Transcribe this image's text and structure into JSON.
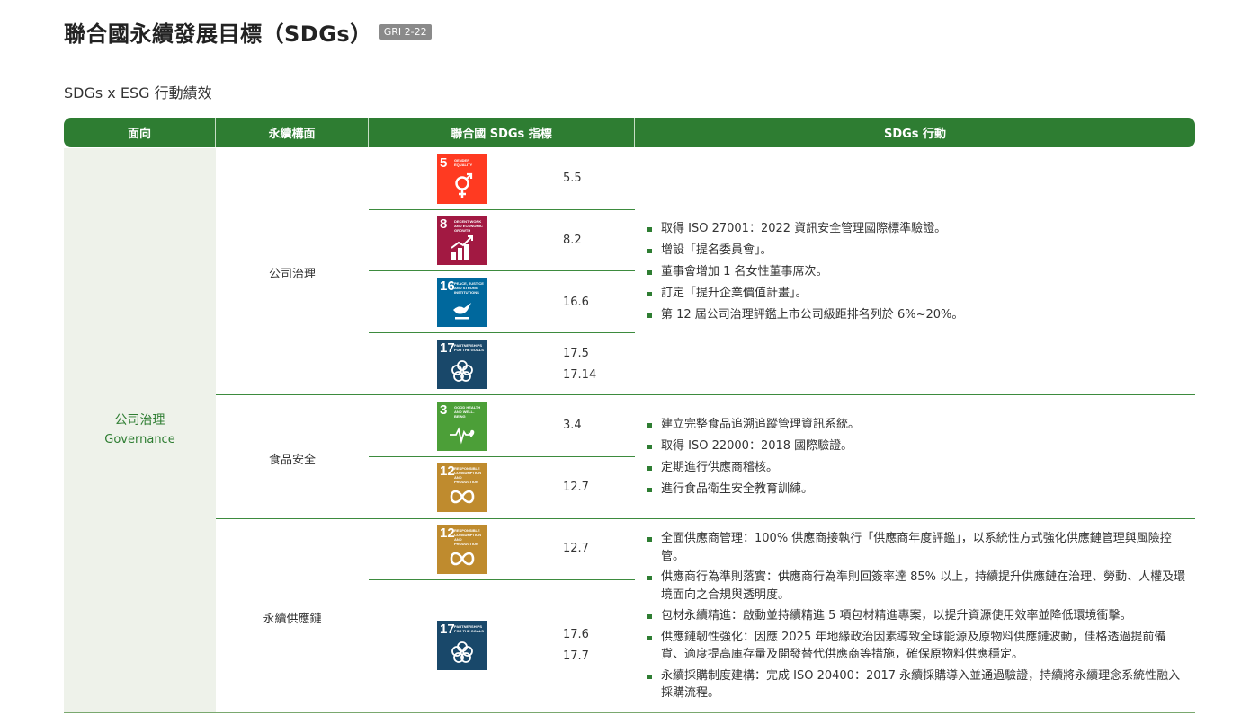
{
  "title": "聯合國永續發展目標（SDGs）",
  "gri_tag": "GRI 2-22",
  "subtitle": "SDGs x ESG 行動績效",
  "header": {
    "col1": "面向",
    "col2": "永續構面",
    "col3": "聯合國 SDGs 指標",
    "col4": "SDGs 行動"
  },
  "aspect": {
    "zh": "公司治理",
    "en": "Governance"
  },
  "sdg_icons": {
    "s3": {
      "num": "3",
      "caption": "GOOD HEALTH AND WELL-BEING",
      "color": "#4c9f38"
    },
    "s5": {
      "num": "5",
      "caption": "GENDER EQUALITY",
      "color": "#ff3a21"
    },
    "s8": {
      "num": "8",
      "caption": "DECENT WORK AND ECONOMIC GROWTH",
      "color": "#a21942"
    },
    "s12": {
      "num": "12",
      "caption": "RESPONSIBLE CONSUMPTION AND PRODUCTION",
      "color": "#bf8b2e"
    },
    "s16": {
      "num": "16",
      "caption": "PEACE, JUSTICE AND STRONG INSTITUTIONS",
      "color": "#00689d"
    },
    "s17": {
      "num": "17",
      "caption": "PARTNERSHIPS FOR THE GOALS",
      "color": "#19486a"
    }
  },
  "sections": [
    {
      "dimension": "公司治理",
      "indicators": [
        "5.5",
        "8.2",
        "16.6",
        "17.5",
        "17.14"
      ],
      "actions": [
        "取得 ISO 27001：2022 資訊安全管理國際標準驗證。",
        "增設「提名委員會」。",
        "董事會增加 1 名女性董事席次。",
        "訂定「提升企業價值計畫」。",
        "第 12 屆公司治理評鑑上市公司級距排名列於 6%~20%。"
      ]
    },
    {
      "dimension": "食品安全",
      "indicators": [
        "3.4",
        "12.7"
      ],
      "actions": [
        "建立完整食品追溯追蹤管理資訊系統。",
        "取得 ISO 22000：2018 國際驗證。",
        "定期進行供應商稽核。",
        "進行食品衛生安全教育訓練。"
      ]
    },
    {
      "dimension": "永續供應鏈",
      "indicators": [
        "12.7",
        "17.6",
        "17.7"
      ],
      "actions": [
        "全面供應商管理：100% 供應商接執行「供應商年度評鑑」，以系統性方式強化供應鏈管理與風險控管。",
        "供應商行為準則落實：供應商行為準則回簽率達 85% 以上，持續提升供應鏈在治理、勞動、人權及環境面向之合規與透明度。",
        "包材永續精進：啟動並持續精進 5 項包材精進專案，以提升資源使用效率並降低環境衝擊。",
        "供應鏈韌性強化：因應 2025 年地緣政治因素導致全球能源及原物料供應鏈波動，佳格透過提前備貨、適度提高庫存量及開發替代供應商等措施，確保原物料供應穩定。",
        "永續採購制度建構：完成 ISO 20400：2017 永續採購導入並通過驗證，持續將永續理念系統性融入採購流程。"
      ]
    }
  ]
}
